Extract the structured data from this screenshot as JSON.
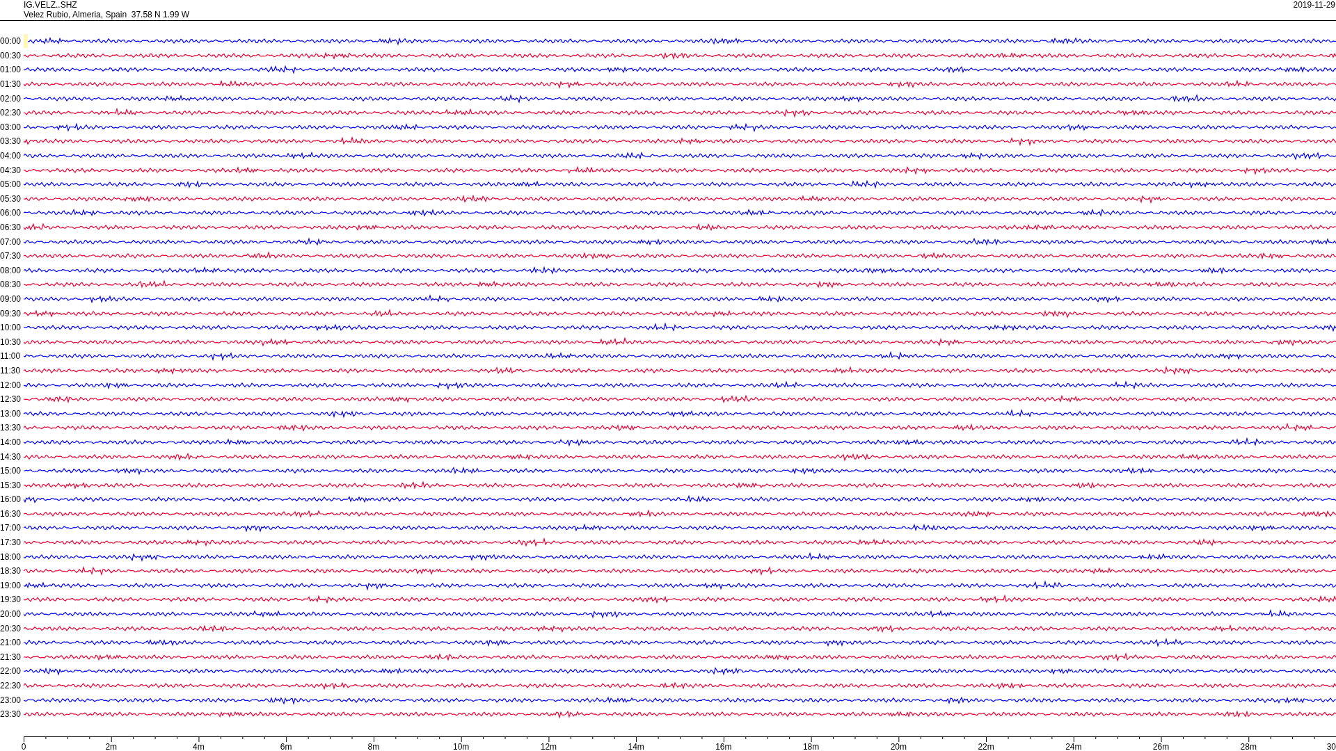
{
  "header": {
    "station": "IG.VELZ..SHZ",
    "location": "Velez Rubio, Almeria, Spain  37.58 N 1.99 W",
    "date": "2019-11-29"
  },
  "traces": [
    {
      "label": "00:00",
      "color": "#0000ff"
    },
    {
      "label": "00:30",
      "color": "#ee0033"
    },
    {
      "label": "01:00",
      "color": "#0000ff"
    },
    {
      "label": "01:30",
      "color": "#ee0033"
    },
    {
      "label": "02:00",
      "color": "#0000ff"
    },
    {
      "label": "02:30",
      "color": "#ee0033"
    },
    {
      "label": "03:00",
      "color": "#0000ff"
    },
    {
      "label": "03:30",
      "color": "#ee0033"
    },
    {
      "label": "04:00",
      "color": "#0000ff"
    },
    {
      "label": "04:30",
      "color": "#ee0033"
    },
    {
      "label": "05:00",
      "color": "#0000ff"
    },
    {
      "label": "05:30",
      "color": "#ee0033"
    },
    {
      "label": "06:00",
      "color": "#0000ff"
    },
    {
      "label": "06:30",
      "color": "#ee0033"
    },
    {
      "label": "07:00",
      "color": "#0000ff"
    },
    {
      "label": "07:30",
      "color": "#ee0033"
    },
    {
      "label": "08:00",
      "color": "#0000ff"
    },
    {
      "label": "08:30",
      "color": "#ee0033"
    },
    {
      "label": "09:00",
      "color": "#0000ff"
    },
    {
      "label": "09:30",
      "color": "#ee0033"
    },
    {
      "label": "10:00",
      "color": "#0000ff"
    },
    {
      "label": "10:30",
      "color": "#ee0033"
    },
    {
      "label": "11:00",
      "color": "#0000ff"
    },
    {
      "label": "11:30",
      "color": "#ee0033"
    },
    {
      "label": "12:00",
      "color": "#0000ff"
    },
    {
      "label": "12:30",
      "color": "#ee0033"
    },
    {
      "label": "13:00",
      "color": "#0000ff"
    },
    {
      "label": "13:30",
      "color": "#ee0033"
    },
    {
      "label": "14:00",
      "color": "#0000ff"
    },
    {
      "label": "14:30",
      "color": "#ee0033"
    },
    {
      "label": "15:00",
      "color": "#0000ff"
    },
    {
      "label": "15:30",
      "color": "#ee0033"
    },
    {
      "label": "16:00",
      "color": "#0000ff"
    },
    {
      "label": "16:30",
      "color": "#ee0033"
    },
    {
      "label": "17:00",
      "color": "#0000ff"
    },
    {
      "label": "17:30",
      "color": "#ee0033"
    },
    {
      "label": "18:00",
      "color": "#0000ff"
    },
    {
      "label": "18:30",
      "color": "#ee0033"
    },
    {
      "label": "19:00",
      "color": "#0000ff"
    },
    {
      "label": "19:30",
      "color": "#ee0033"
    },
    {
      "label": "20:00",
      "color": "#0000ff"
    },
    {
      "label": "20:30",
      "color": "#ee0033"
    },
    {
      "label": "21:00",
      "color": "#0000ff"
    },
    {
      "label": "21:30",
      "color": "#ee0033"
    },
    {
      "label": "22:00",
      "color": "#0000ff"
    },
    {
      "label": "22:30",
      "color": "#ee0033"
    },
    {
      "label": "23:00",
      "color": "#0000ff"
    },
    {
      "label": "23:30",
      "color": "#ee0033"
    }
  ],
  "x_axis": {
    "labels": [
      "0",
      "2m",
      "4m",
      "6m",
      "8m",
      "10m",
      "12m",
      "14m",
      "16m",
      "18m",
      "20m",
      "22m",
      "24m",
      "26m",
      "28m",
      "30"
    ]
  }
}
